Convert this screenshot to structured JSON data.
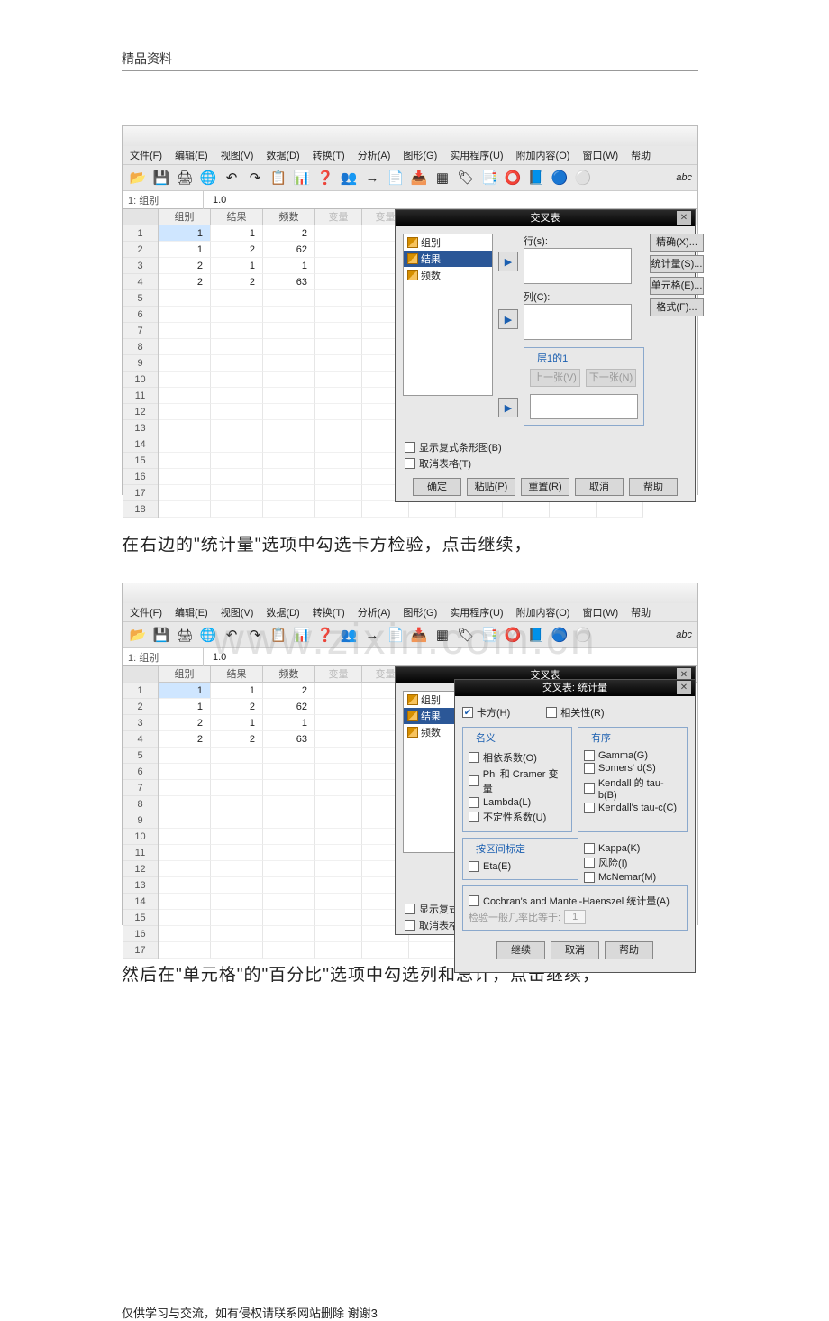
{
  "doc": {
    "header": "精品资料",
    "text1": "在右边的\"统计量\"选项中勾选卡方检验，点击继续，",
    "text2": "然后在\"单元格\"的\"百分比\"选项中勾选列和总计，点击继续，",
    "footer": "仅供学习与交流，如有侵权请联系网站删除 谢谢3",
    "watermark": "www.zixin.com.cn"
  },
  "spss": {
    "menus": [
      "文件(F)",
      "编辑(E)",
      "视图(V)",
      "数据(D)",
      "转换(T)",
      "分析(A)",
      "图形(G)",
      "实用程序(U)",
      "附加内容(O)",
      "窗口(W)",
      "帮助"
    ],
    "toolbar_icons": [
      "📂",
      "💾",
      "🖨",
      "🌐",
      "↶",
      "↷",
      "📋",
      "📊",
      "❓",
      "👥",
      "→",
      "📄",
      "📥",
      "▦",
      "🏷",
      "📑",
      "⭕",
      "📘",
      "🔵",
      "⚪"
    ],
    "abc": "abc",
    "cellbar": {
      "label": "1: 组别",
      "value": "1.0"
    },
    "cols": [
      "组别",
      "结果",
      "频数"
    ],
    "dimcols": [
      "变量",
      "变量",
      "变量",
      "变量",
      "变量",
      "变量",
      "变量"
    ],
    "rows": [
      {
        "vals": [
          "1",
          "1",
          "2"
        ]
      },
      {
        "vals": [
          "1",
          "2",
          "62"
        ]
      },
      {
        "vals": [
          "2",
          "1",
          "1"
        ]
      },
      {
        "vals": [
          "2",
          "2",
          "63"
        ]
      }
    ],
    "empty_rows": 14
  },
  "dlg1": {
    "title": "交叉表",
    "vars": [
      "组别",
      "结果",
      "频数"
    ],
    "selected": 1,
    "row_lbl": "行(s):",
    "col_lbl": "列(C):",
    "layer": "层1的1",
    "prev": "上一张(V)",
    "next": "下一张(N)",
    "chk1": "显示复式条形图(B)",
    "chk2": "取消表格(T)",
    "rbtns": [
      "精确(X)...",
      "统计量(S)...",
      "单元格(E)...",
      "格式(F)..."
    ],
    "foot": [
      "确定",
      "粘贴(P)",
      "重置(R)",
      "取消",
      "帮助"
    ]
  },
  "dlg2": {
    "title": "交叉表: 统计量",
    "chi": "卡方(H)",
    "corr": "相关性(R)",
    "g_nominal": "名义",
    "g_ordinal": "有序",
    "nominal": [
      "相依系数(O)",
      "Phi 和 Cramer 变量",
      "Lambda(L)",
      "不定性系数(U)"
    ],
    "ordinal": [
      "Gamma(G)",
      "Somers' d(S)",
      "Kendall 的 tau-b(B)",
      "Kendall's tau-c(C)"
    ],
    "interval": "按区间标定",
    "eta": "Eta(E)",
    "kappa": "Kappa(K)",
    "risk": "风险(I)",
    "mcnemar": "McNemar(M)",
    "cmh": "Cochran's and Mantel-Haenszel 统计量(A)",
    "odds": "检验一般几率比等于:",
    "odds_val": "1",
    "foot": [
      "继续",
      "取消",
      "帮助"
    ]
  }
}
